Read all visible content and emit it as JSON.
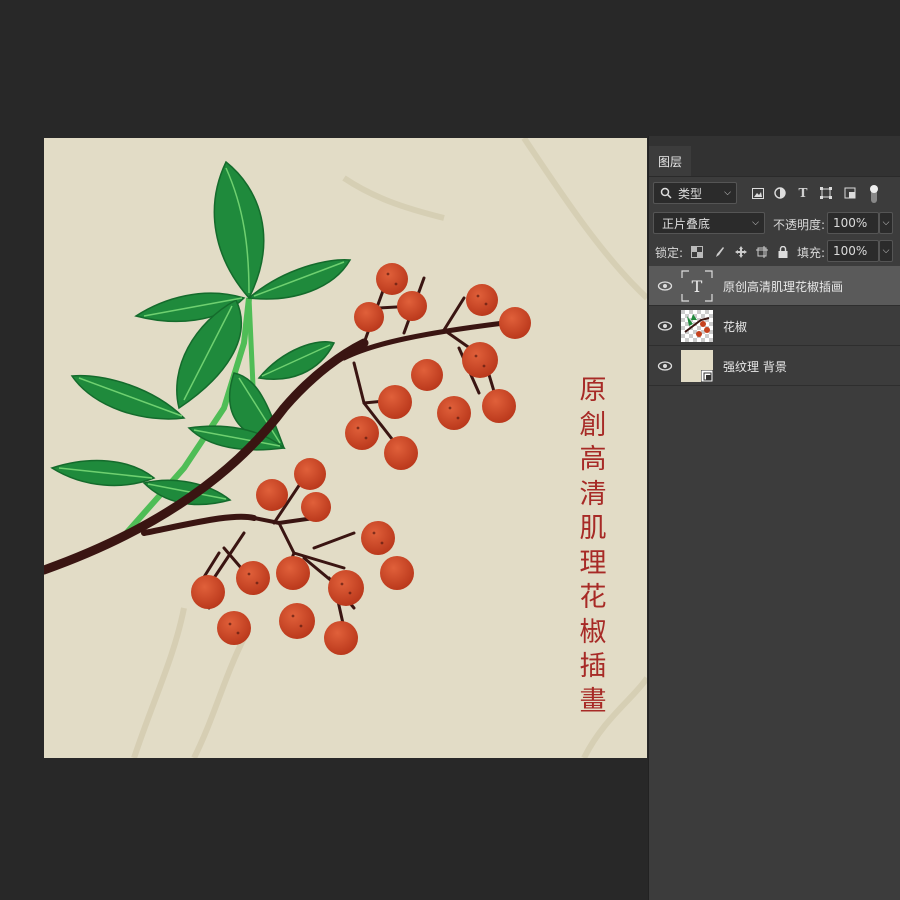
{
  "artwork": {
    "vertical_title": [
      "原",
      "創",
      "高",
      "清",
      "肌",
      "理",
      "花",
      "椒",
      "插",
      "畫"
    ]
  },
  "panel": {
    "tab_label": "图层",
    "filter_kind": "类型",
    "blend_mode": "正片叠底",
    "opacity_label": "不透明度:",
    "opacity_value": "100%",
    "lock_label": "锁定:",
    "fill_label": "填充:",
    "fill_value": "100%",
    "filter_icons": [
      "image-filter-icon",
      "adjustment-filter-icon",
      "type-filter-icon",
      "shape-filter-icon",
      "smart-object-filter-icon"
    ],
    "layers": [
      {
        "name": "原创高清肌理花椒插画",
        "type": "text",
        "selected": true
      },
      {
        "name": "花椒",
        "type": "pixel",
        "selected": false
      },
      {
        "name": "强纹理 背景",
        "type": "smart",
        "selected": false
      }
    ]
  },
  "colors": {
    "app_bg": "#282828",
    "panel_bg": "#3c3c3c",
    "selected_layer": "#5a5a5a",
    "paper": "#e2dcc6",
    "berry": "#c5421e",
    "leaf": "#1f8a3c",
    "branch": "#3a1512",
    "title_red": "#a72a26"
  }
}
